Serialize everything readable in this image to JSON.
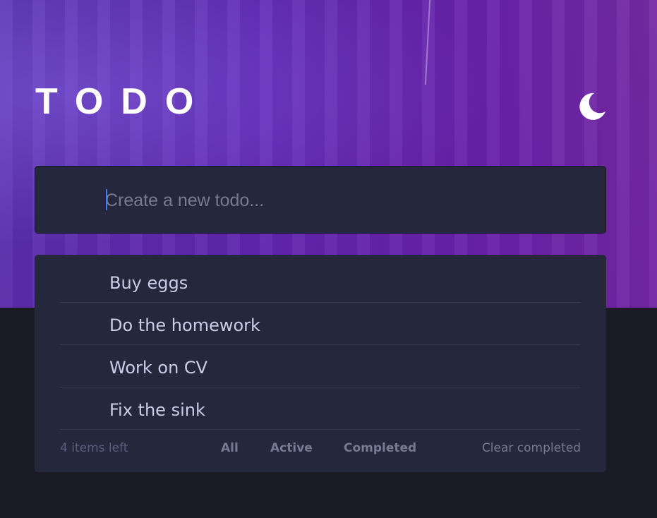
{
  "header": {
    "title": "TODO",
    "theme_toggle_icon": "moon-icon"
  },
  "new_todo": {
    "placeholder": "Create a new todo...",
    "value": ""
  },
  "todos": [
    {
      "text": "Buy eggs",
      "completed": false
    },
    {
      "text": "Do the homework",
      "completed": false
    },
    {
      "text": "Work on CV",
      "completed": false
    },
    {
      "text": "Fix the sink",
      "completed": false
    }
  ],
  "footer": {
    "items_left": "4 items left",
    "filters": [
      "All",
      "Active",
      "Completed"
    ],
    "clear_completed": "Clear completed"
  },
  "colors": {
    "card": "#25273c",
    "background": "#1a1b25",
    "text": "#cacde8",
    "muted": "#777a92",
    "accent": "#3a7bfd"
  }
}
